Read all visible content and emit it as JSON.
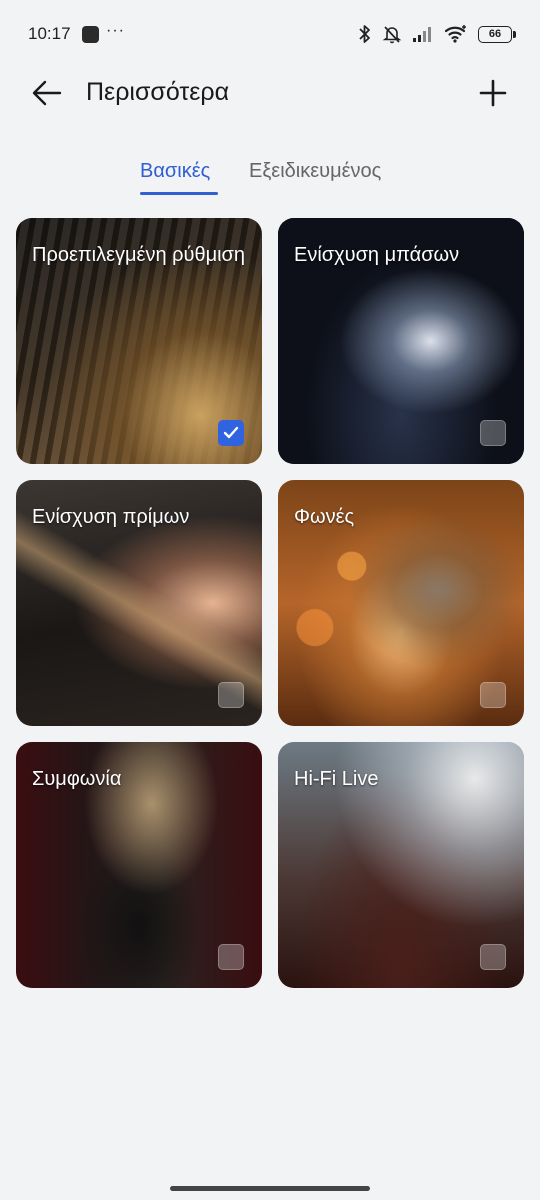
{
  "status_bar": {
    "time": "10:17",
    "dots": "···",
    "battery": "66",
    "icons": [
      "notification-icon",
      "bluetooth-icon",
      "muted-bell-icon",
      "signal-icon",
      "wifi-icon",
      "battery-icon"
    ]
  },
  "header": {
    "title": "Περισσότερα",
    "back_icon": "arrow-left-icon",
    "add_icon": "plus-icon"
  },
  "tabs": [
    {
      "label": "Βασικές",
      "selected": true
    },
    {
      "label": "Εξειδικευμένος",
      "selected": false
    }
  ],
  "accent_color": "#2f5fd0",
  "presets": [
    {
      "label": "Προεπιλεγμένη ρύθμιση",
      "selected": true
    },
    {
      "label": "Ενίσχυση μπάσων",
      "selected": false
    },
    {
      "label": "Ενίσχυση πρίμων",
      "selected": false
    },
    {
      "label": "Φωνές",
      "selected": false
    },
    {
      "label": "Συμφωνία",
      "selected": false
    },
    {
      "label": "Hi-Fi Live",
      "selected": false
    }
  ]
}
